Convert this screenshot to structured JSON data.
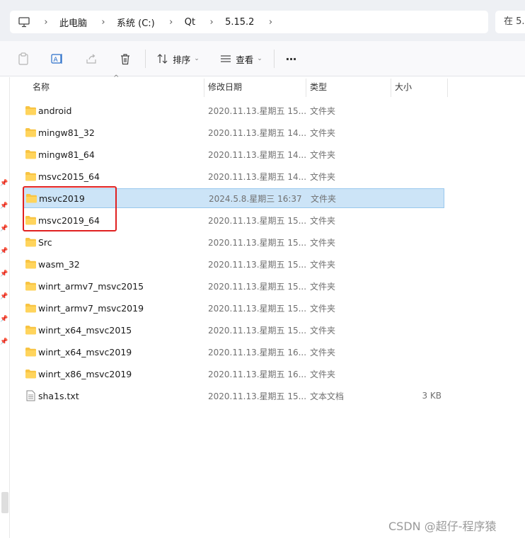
{
  "address": {
    "crumbs": [
      "此电脑",
      "系统 (C:)",
      "Qt",
      "5.15.2"
    ],
    "search_placeholder": "在 5."
  },
  "toolbar": {
    "sort_label": "排序",
    "view_label": "查看",
    "more_label": "···"
  },
  "columns": {
    "name": "名称",
    "date": "修改日期",
    "type": "类型",
    "size": "大小"
  },
  "files": [
    {
      "name": "android",
      "date": "2020.11.13.星期五 15...",
      "type": "文件夹",
      "size": "",
      "kind": "folder"
    },
    {
      "name": "mingw81_32",
      "date": "2020.11.13.星期五 14...",
      "type": "文件夹",
      "size": "",
      "kind": "folder"
    },
    {
      "name": "mingw81_64",
      "date": "2020.11.13.星期五 14...",
      "type": "文件夹",
      "size": "",
      "kind": "folder"
    },
    {
      "name": "msvc2015_64",
      "date": "2020.11.13.星期五 14...",
      "type": "文件夹",
      "size": "",
      "kind": "folder"
    },
    {
      "name": "msvc2019",
      "date": "2024.5.8.星期三 16:37",
      "type": "文件夹",
      "size": "",
      "kind": "folder",
      "selected": true
    },
    {
      "name": "msvc2019_64",
      "date": "2020.11.13.星期五 15...",
      "type": "文件夹",
      "size": "",
      "kind": "folder"
    },
    {
      "name": "Src",
      "date": "2020.11.13.星期五 15...",
      "type": "文件夹",
      "size": "",
      "kind": "folder"
    },
    {
      "name": "wasm_32",
      "date": "2020.11.13.星期五 15...",
      "type": "文件夹",
      "size": "",
      "kind": "folder"
    },
    {
      "name": "winrt_armv7_msvc2015",
      "date": "2020.11.13.星期五 15...",
      "type": "文件夹",
      "size": "",
      "kind": "folder"
    },
    {
      "name": "winrt_armv7_msvc2019",
      "date": "2020.11.13.星期五 15...",
      "type": "文件夹",
      "size": "",
      "kind": "folder"
    },
    {
      "name": "winrt_x64_msvc2015",
      "date": "2020.11.13.星期五 15...",
      "type": "文件夹",
      "size": "",
      "kind": "folder"
    },
    {
      "name": "winrt_x64_msvc2019",
      "date": "2020.11.13.星期五 16...",
      "type": "文件夹",
      "size": "",
      "kind": "folder"
    },
    {
      "name": "winrt_x86_msvc2019",
      "date": "2020.11.13.星期五 16...",
      "type": "文件夹",
      "size": "",
      "kind": "folder"
    },
    {
      "name": "sha1s.txt",
      "date": "2020.11.13.星期五 15...",
      "type": "文本文档",
      "size": "3 KB",
      "kind": "text-file"
    }
  ],
  "watermark": "CSDN @超仔-程序猿",
  "colors": {
    "folder": "#f8c443",
    "selection": "#cce4f7",
    "highlight_box": "#e02020"
  }
}
